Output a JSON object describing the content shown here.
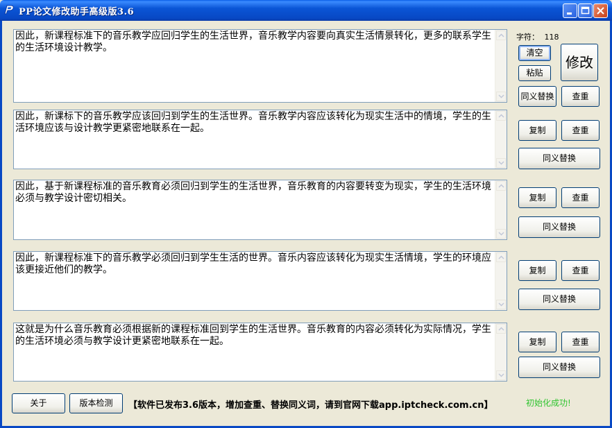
{
  "window": {
    "title": "PP论文修改助手高级版3.6"
  },
  "char_count": {
    "label": "字符：",
    "value": "118"
  },
  "buttons": {
    "clear": "清空",
    "paste": "粘贴",
    "modify": "修改",
    "synonym": "同义替换",
    "check": "查重",
    "copy": "复制",
    "about": "关于",
    "version_check": "版本检测"
  },
  "panels": [
    {
      "text": "因此，新课程标准下的音乐教学应回归学生的生活世界，音乐教学内容要向真实生活情景转化，更多的联系学生的生活环境设计教学。"
    },
    {
      "text": "因此，新课标下的音乐教学应该回归到学生的生活世界。音乐教学内容应该转化为现实生活中的情境，学生的生活环境应该与设计教学更紧密地联系在一起。"
    },
    {
      "text": "因此，基于新课程标准的音乐教育必须回归到学生的生活世界，音乐教育的内容要转变为现实，学生的生活环境必须与教学设计密切相关。"
    },
    {
      "text": "因此，新课程标准下的音乐教学必须回归到学生生活的世界。音乐内容应该转化为现实生活情境，学生的环境应该更接近他们的教学。"
    },
    {
      "text": "这就是为什么音乐教育必须根据新的课程标准回到学生的生活世界。音乐教育的内容必须转化为实际情况，学生的生活环境必须与教学设计更紧密地联系在一起。"
    }
  ],
  "notice": "【软件已发布3.6版本，增加查重、替换同义词，请到官网下载app.iptcheck.com.cn】",
  "status": "初始化成功!"
}
